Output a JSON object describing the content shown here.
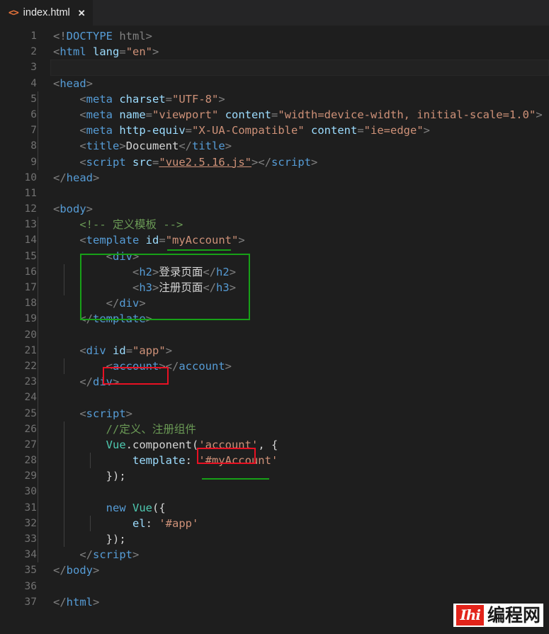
{
  "tab": {
    "icon": "html-file-icon",
    "filename": "index.html",
    "close": "✕"
  },
  "editor": {
    "language": "html",
    "theme": "dark-plus",
    "current_line": 3,
    "total_lines": 37,
    "line_numbers": [
      1,
      2,
      3,
      4,
      5,
      6,
      7,
      8,
      9,
      10,
      11,
      12,
      13,
      14,
      15,
      16,
      17,
      18,
      19,
      20,
      21,
      22,
      23,
      24,
      25,
      26,
      27,
      28,
      29,
      30,
      31,
      32,
      33,
      34,
      35,
      36,
      37
    ]
  },
  "code_lines": {
    "l1": "<!DOCTYPE html>",
    "l2": "<html lang=\"en\">",
    "l3": "",
    "l4": "<head>",
    "l5": "    <meta charset=\"UTF-8\">",
    "l6": "    <meta name=\"viewport\" content=\"width=device-width, initial-scale=1.0\">",
    "l7": "    <meta http-equiv=\"X-UA-Compatible\" content=\"ie=edge\">",
    "l8": "    <title>Document</title>",
    "l9": "    <script src=\"vue2.5.16.js\"></script>",
    "l10": "</head>",
    "l11": "",
    "l12": "<body>",
    "l13": "    <!-- 定义模板 -->",
    "l14": "    <template id=\"myAccount\">",
    "l15": "        <div>",
    "l16": "            <h2>登录页面</h2>",
    "l17": "            <h3>注册页面</h3>",
    "l18": "        </div>",
    "l19": "    </template>",
    "l20": "",
    "l21": "    <div id=\"app\">",
    "l22": "        <account></account>",
    "l23": "    </div>",
    "l24": "",
    "l25": "    <script>",
    "l26": "        //定义、注册组件",
    "l27": "        Vue.component('account', {",
    "l28": "            template: '#myAccount'",
    "l29": "        });",
    "l30": "",
    "l31": "        new Vue({",
    "l32": "            el: '#app'",
    "l33": "        });",
    "l34": "    </script>",
    "l35": "</body>",
    "l36": "",
    "l37": "</html>"
  },
  "tokens": {
    "doctype_open": "<!",
    "doctype_name": "DOCTYPE",
    "doctype_value": " html",
    "gt": ">",
    "lt": "<",
    "lt_slash": "</",
    "html_tag": "html",
    "head_tag": "head",
    "body_tag": "body",
    "meta_tag": "meta",
    "title_tag": "title",
    "script_tag": "script",
    "template_tag": "template",
    "div_tag": "div",
    "h2_tag": "h2",
    "h3_tag": "h3",
    "account_tag": "account",
    "attr_lang": "lang",
    "attr_charset": "charset",
    "attr_name": "name",
    "attr_content": "content",
    "attr_httpequiv": "http-equiv",
    "attr_src": "src",
    "attr_id": "id",
    "eq": "=",
    "val_en": "\"en\"",
    "val_utf8": "\"UTF-8\"",
    "val_viewport": "\"viewport\"",
    "val_viewport_content": "\"width=device-width, initial-scale=1.0\"",
    "val_xua": "\"X-UA-Compatible\"",
    "val_ieedge": "\"ie=edge\"",
    "val_vuejs": "\"vue2.5.16.js\"",
    "val_myaccount": "\"myAccount\"",
    "val_app": "\"app\"",
    "text_document": "Document",
    "text_login_page": "登录页面",
    "text_register_page": "注册页面",
    "comment_define_template": "<!-- 定义模板 -->",
    "comment_define_register": "//定义、注册组件",
    "obj_vue": "Vue",
    "dot_component": ".component(",
    "str_account": "'account'",
    "comma_brace": ", {",
    "prop_template": "template",
    "colon": ": ",
    "str_hash_myaccount": "'#myAccount'",
    "close_brace_paren": "});",
    "kw_new": "new",
    "class_vue": "Vue",
    "paren_brace": "({",
    "prop_el": "el",
    "str_hash_app": "'#app'"
  },
  "annotations": [
    {
      "id": "green-box-template-div",
      "type": "box",
      "color": "#17a017",
      "target": "template div block lines 15-18"
    },
    {
      "id": "green-underline-myaccount-id",
      "type": "underline",
      "color": "#17a017",
      "target": "myAccount id value line 14"
    },
    {
      "id": "red-box-account-element",
      "type": "box",
      "color": "#e81123",
      "target": "<account> opening tag line 22"
    },
    {
      "id": "red-box-account-string",
      "type": "box",
      "color": "#e81123",
      "target": "'account' string line 27"
    },
    {
      "id": "green-underline-myaccount-template",
      "type": "underline",
      "color": "#17a017",
      "target": "'#myAccount' string line 28"
    }
  ],
  "watermark": {
    "logo_text": "Ihi",
    "text": "编程网"
  },
  "colors": {
    "background": "#1e1e1e",
    "tabbar": "#252526",
    "tag": "#569cd6",
    "attribute": "#9cdcfe",
    "string": "#ce9178",
    "comment": "#6a9955",
    "punctuation": "#808080",
    "classname": "#4ec9b0",
    "linenumber": "#727272",
    "annotation_green": "#17a017",
    "annotation_red": "#e81123"
  }
}
